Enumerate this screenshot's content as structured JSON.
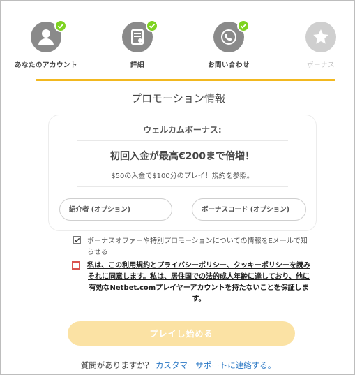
{
  "steps": [
    {
      "label": "あなたのアカウント",
      "icon": "user-icon",
      "completed": true
    },
    {
      "label": "詳細",
      "icon": "document-icon",
      "completed": true
    },
    {
      "label": "お問い合わせ",
      "icon": "phone-icon",
      "completed": true
    },
    {
      "label": "ボーナス",
      "icon": "star-icon",
      "completed": false
    }
  ],
  "page": {
    "title": "プロモーション情報"
  },
  "bonus": {
    "title": "ウェルカムボーナス:",
    "headline": "初回入金が最高€200まで倍増！",
    "subtext": "$50の入金で$100分のプレイ！規約を参照。"
  },
  "inputs": {
    "referral_placeholder": "紹介者 (オプション)",
    "bonus_code_placeholder": "ボーナスコード (オプション)"
  },
  "options": {
    "email_optin": {
      "text": "ボーナスオファーや特別プロモーションについての情報をEメールで知らせる",
      "checked": true
    },
    "terms": {
      "text": "私は、この利用規約とプライバシーポリシー、クッキーポリシーを読みそれに同意します。私は、居住国での法的成人年齢に達しており、他に有効なNetbet.comプレイヤーアカウントを持たないことを保証します。",
      "checked": false
    }
  },
  "actions": {
    "play_label": "プレイし始める"
  },
  "help": {
    "question": "質問がありますか？ ",
    "link_text": "カスタマーサポートに連絡する。"
  },
  "colors": {
    "accent": "#f2b81f",
    "check_green": "#7ed321",
    "button_disabled": "#fbe2a4",
    "link": "#2b78c5",
    "error": "#d9534f"
  }
}
